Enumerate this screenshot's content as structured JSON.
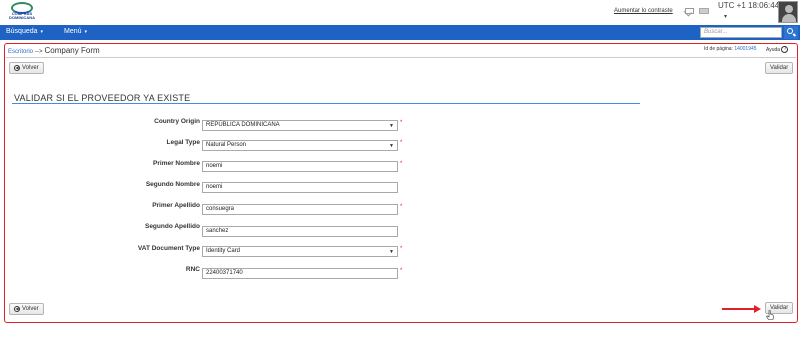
{
  "header": {
    "logo_text": "COMPRAS DOMINICANA",
    "contrast_link": "Aumentar lo contraste",
    "clock": "UTC +1 18:06:44",
    "clock_caret": "▾"
  },
  "nav": {
    "items": [
      {
        "label": "Búsqueda",
        "caret": "▾"
      },
      {
        "label": "Menú",
        "caret": "▾"
      }
    ],
    "search_placeholder": "Buscar..."
  },
  "breadcrumb": {
    "link": "Escritorio",
    "separator": "-->",
    "current": "Company Form"
  },
  "page_info": {
    "label": "Id de página:",
    "id": "14001945",
    "help": "Ayuda",
    "help_icon": "?"
  },
  "buttons": {
    "back": "Volver",
    "back_icon": "◀",
    "validate": "Validar"
  },
  "section_title": "VALIDAR SI EL PROVEEDOR YA EXISTE",
  "form": {
    "required_mark": "*",
    "fields": [
      {
        "label": "Country Origin",
        "value": "REPÚBLICA DOMINICANA",
        "type": "select"
      },
      {
        "label": "Legal Type",
        "value": "Natural Person",
        "type": "select"
      },
      {
        "label": "Primer Nombre",
        "value": "noemi",
        "type": "text"
      },
      {
        "label": "Segundo Nombre",
        "value": "noemi",
        "type": "text"
      },
      {
        "label": "Primer Apellido",
        "value": "consuegra",
        "type": "text"
      },
      {
        "label": "Segundo Apellido",
        "value": "sanchez",
        "type": "text"
      },
      {
        "label": "VAT Document Type",
        "value": "Identity Card",
        "type": "select"
      },
      {
        "label": "RNC",
        "value": "22400371740",
        "type": "text"
      }
    ],
    "select_arrow": "▼"
  },
  "colors": {
    "nav_blue": "#1e63c3",
    "highlight_red": "#e0202a",
    "link_blue": "#2a6bd0"
  }
}
